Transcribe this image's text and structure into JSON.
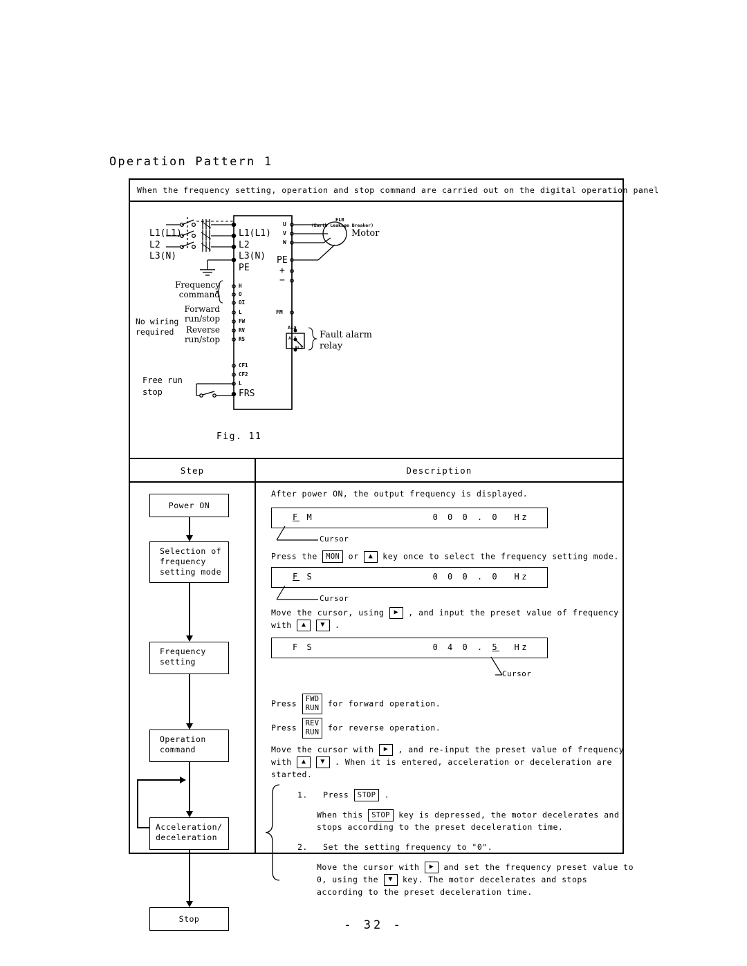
{
  "page": {
    "heading": "Operation Pattern 1",
    "footer": "- 32 -"
  },
  "banner": {
    "text": "When the frequency setting, operation and stop command are carried out on the digital operation panel"
  },
  "figure": {
    "caption": "Fig. 11",
    "breaker": {
      "abbr": "ELB",
      "full": "(Earth Leakage Breaker)"
    },
    "supply_labels": [
      "L1(L1)",
      "L2",
      "L3(N)"
    ],
    "inverter_input_terminals": [
      "L1(L1)",
      "L2",
      "L3(N)",
      "PE"
    ],
    "inverter_output_terminals": [
      "U",
      "V",
      "W",
      "PE",
      "+",
      "−"
    ],
    "control_terminals": [
      "H",
      "O",
      "OI",
      "L",
      "FW",
      "RV",
      "RS",
      "CF1",
      "CF2",
      "L",
      "FRS"
    ],
    "monitor_terminal": "FM",
    "relay_terminals": [
      "ALa",
      "AL1",
      "AL2"
    ],
    "annotations": {
      "motor": "Motor",
      "frequency_command": "Frequency\ncommand",
      "forward": "Forward\nrun/stop",
      "reverse": "Reverse\nrun/stop",
      "no_wiring": "No wiring\nrequired",
      "free_run_stop": "Free run\nstop",
      "fault_alarm_relay": "Fault alarm\nrelay"
    }
  },
  "table": {
    "headers": {
      "step": "Step",
      "description": "Description"
    },
    "steps": [
      {
        "id": "power-on",
        "label": "Power ON"
      },
      {
        "id": "selection-of-frequency-setting-mode",
        "label": "Selection of\nfrequency\nsetting mode"
      },
      {
        "id": "frequency-setting",
        "label": "Frequency\nsetting"
      },
      {
        "id": "operation-command",
        "label": "Operation\ncommand"
      },
      {
        "id": "acceleration-deceleration",
        "label": "Acceleration/\ndeceleration"
      },
      {
        "id": "stop",
        "label": "Stop"
      }
    ],
    "description": {
      "line_power_on": "After power ON, the output frequency is displayed.",
      "display_1": {
        "mode_first": "F",
        "mode_rest": " M",
        "value": "0 0 0 . 0",
        "unit": "Hz"
      },
      "cursor_label_1": "Cursor",
      "line_press_mon_a": "Press the",
      "line_press_mon_b": "or",
      "line_press_mon_c": "key once to select the frequency setting mode.",
      "key_mon": "MON",
      "key_up": "▲",
      "key_down": "▼",
      "key_right": "▶",
      "display_2": {
        "mode_first": "F",
        "mode_rest": " S",
        "value": "0 0 0 . 0",
        "unit": "Hz"
      },
      "cursor_label_2": "Cursor",
      "line_move_cursor_a": "Move the cursor, using",
      "line_move_cursor_b": ", and input the preset value of frequency",
      "line_move_cursor_c": "with",
      "line_move_cursor_d": ".",
      "display_3": {
        "mode": "F S",
        "value_pre": "0 4 0 . ",
        "value_cursor": "5",
        "unit": "Hz"
      },
      "cursor_label_3": "Cursor",
      "press_fwd_a": "Press",
      "press_fwd_b": "for forward operation.",
      "key_fwd_run": [
        "FWD",
        "RUN"
      ],
      "press_rev_a": "Press",
      "press_rev_b": "for reverse operation.",
      "key_rev_run": [
        "REV",
        "RUN"
      ],
      "reinput_a": "Move the cursor with",
      "reinput_b": ", and re-input the preset value of frequency",
      "reinput_c": "with",
      "reinput_d": ".  When it is entered, acceleration or deceleration are",
      "reinput_e": "started.",
      "stop_items": [
        {
          "num": "1.",
          "head_a": "Press",
          "head_b": ".",
          "key": "STOP",
          "body_a": "When this",
          "body_b": "key is depressed, the motor decelerates and",
          "body_c": "stops according to the preset deceleration time."
        },
        {
          "num": "2.",
          "head_a": "Set the setting frequency to \"0\".",
          "body_a": "Move the cursor with",
          "body_b": "and set the frequency preset value to",
          "body_c": "0, using the",
          "body_d": "key.  The motor decelerates and stops",
          "body_e": "according to the preset deceleration time."
        }
      ]
    }
  }
}
